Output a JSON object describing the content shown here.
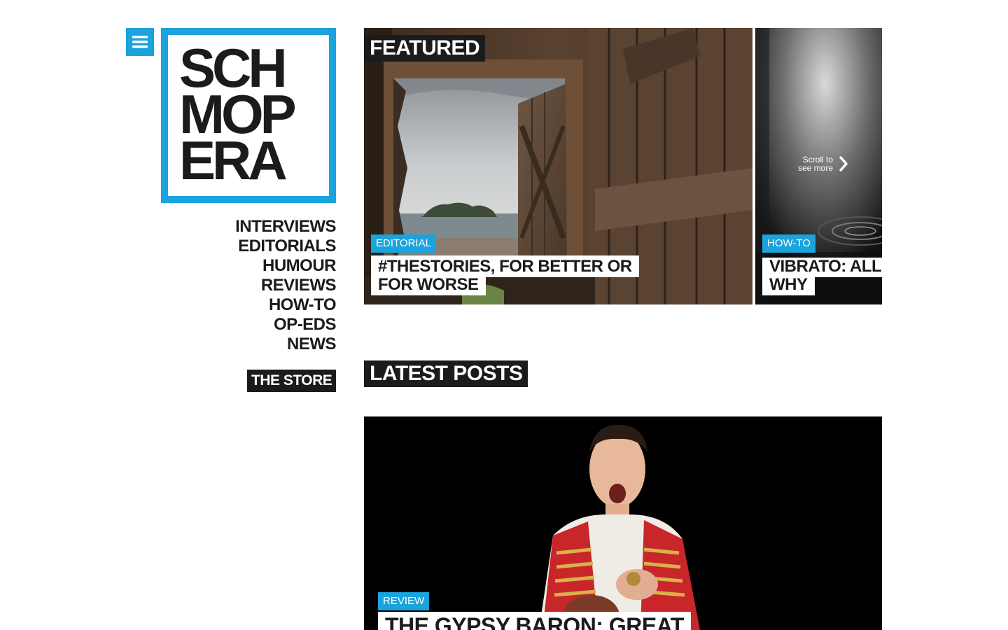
{
  "brand": {
    "logo_lines": [
      "SCH",
      "MOP",
      "ERA"
    ],
    "accent_color": "#1aa3dc",
    "ink_color": "#1b1b1b"
  },
  "menu": {
    "icon": "hamburger-icon"
  },
  "nav": {
    "items": [
      "INTERVIEWS",
      "EDITORIALS",
      "HUMOUR",
      "REVIEWS",
      "HOW-TO",
      "OP-EDS",
      "NEWS"
    ],
    "store_label": "THE STORE"
  },
  "featured": {
    "heading": "FEATURED",
    "cards": [
      {
        "category": "EDITORIAL",
        "title": "#THESTORIES, FOR BETTER OR FOR WORSE"
      },
      {
        "category": "HOW-TO",
        "title": "VIBRATO: ALL WHY"
      }
    ],
    "scroll_hint": {
      "line1": "Scroll to",
      "line2": "see more",
      "icon": "chevron-right-icon"
    }
  },
  "latest": {
    "heading": "LATEST POSTS",
    "posts": [
      {
        "category": "REVIEW",
        "title": "THE GYPSY BARON: GREAT"
      }
    ]
  }
}
